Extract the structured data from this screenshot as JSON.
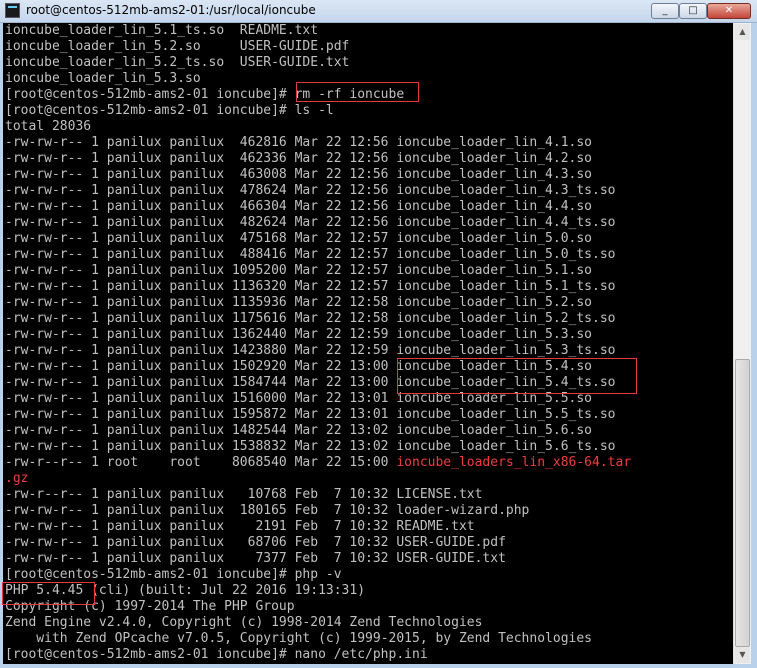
{
  "window": {
    "title": "root@centos-512mb-ams2-01:/usr/local/ioncube",
    "buttons": {
      "minimize": "_",
      "maximize": "□",
      "close": "✕"
    },
    "icon": "putty-terminal-icon"
  },
  "terminal": {
    "lines": [
      "ioncube_loader_lin_5.1_ts.so  README.txt",
      "ioncube_loader_lin_5.2.so     USER-GUIDE.pdf",
      "ioncube_loader_lin_5.2_ts.so  USER-GUIDE.txt",
      "ioncube_loader_lin_5.3.so",
      "[root@centos-512mb-ams2-01 ioncube]# rm -rf ioncube",
      "[root@centos-512mb-ams2-01 ioncube]# ls -l",
      "total 28036",
      "-rw-rw-r-- 1 panilux panilux  462816 Mar 22 12:56 ioncube_loader_lin_4.1.so",
      "-rw-rw-r-- 1 panilux panilux  462336 Mar 22 12:56 ioncube_loader_lin_4.2.so",
      "-rw-rw-r-- 1 panilux panilux  463008 Mar 22 12:56 ioncube_loader_lin_4.3.so",
      "-rw-rw-r-- 1 panilux panilux  478624 Mar 22 12:56 ioncube_loader_lin_4.3_ts.so",
      "-rw-rw-r-- 1 panilux panilux  466304 Mar 22 12:56 ioncube_loader_lin_4.4.so",
      "-rw-rw-r-- 1 panilux panilux  482624 Mar 22 12:56 ioncube_loader_lin_4.4_ts.so",
      "-rw-rw-r-- 1 panilux panilux  475168 Mar 22 12:57 ioncube_loader_lin_5.0.so",
      "-rw-rw-r-- 1 panilux panilux  488416 Mar 22 12:57 ioncube_loader_lin_5.0_ts.so",
      "-rw-rw-r-- 1 panilux panilux 1095200 Mar 22 12:57 ioncube_loader_lin_5.1.so",
      "-rw-rw-r-- 1 panilux panilux 1136320 Mar 22 12:57 ioncube_loader_lin_5.1_ts.so",
      "-rw-rw-r-- 1 panilux panilux 1135936 Mar 22 12:58 ioncube_loader_lin_5.2.so",
      "-rw-rw-r-- 1 panilux panilux 1175616 Mar 22 12:58 ioncube_loader_lin_5.2_ts.so",
      "-rw-rw-r-- 1 panilux panilux 1362440 Mar 22 12:59 ioncube_loader_lin_5.3.so",
      "-rw-rw-r-- 1 panilux panilux 1423880 Mar 22 12:59 ioncube_loader_lin_5.3_ts.so",
      "-rw-rw-r-- 1 panilux panilux 1502920 Mar 22 13:00 ioncube_loader_lin_5.4.so",
      "-rw-rw-r-- 1 panilux panilux 1584744 Mar 22 13:00 ioncube_loader_lin_5.4_ts.so",
      "-rw-rw-r-- 1 panilux panilux 1516000 Mar 22 13:01 ioncube_loader_lin_5.5.so",
      "-rw-rw-r-- 1 panilux panilux 1595872 Mar 22 13:01 ioncube_loader_lin_5.5_ts.so",
      "-rw-rw-r-- 1 panilux panilux 1482544 Mar 22 13:02 ioncube_loader_lin_5.6.so",
      "-rw-rw-r-- 1 panilux panilux 1538832 Mar 22 13:02 ioncube_loader_lin_5.6_ts.so",
      "-rw-r--r-- 1 root    root    8068540 Mar 22 15:00 ",
      "",
      "-rw-r--r-- 1 panilux panilux   10768 Feb  7 10:32 LICENSE.txt",
      "-rw-rw-r-- 1 panilux panilux  180165 Feb  7 10:32 loader-wizard.php",
      "-rw-rw-r-- 1 panilux panilux    2191 Feb  7 10:32 README.txt",
      "-rw-rw-r-- 1 panilux panilux   68706 Feb  7 10:32 USER-GUIDE.pdf",
      "-rw-rw-r-- 1 panilux panilux    7377 Feb  7 10:32 USER-GUIDE.txt",
      "[root@centos-512mb-ams2-01 ioncube]# php -v",
      "PHP 5.4.45 (cli) (built: Jul 22 2016 19:13:31)",
      "Copyright (c) 1997-2014 The PHP Group",
      "Zend Engine v2.4.0, Copyright (c) 1998-2014 Zend Technologies",
      "    with Zend OPcache v7.0.5, Copyright (c) 1999-2015, by Zend Technologies",
      "[root@centos-512mb-ams2-01 ioncube]# nano /etc/php.ini"
    ],
    "archive_name_part1": "ioncube_loaders_lin_x86-64.tar",
    "archive_name_part2": ".gz",
    "colors": {
      "background": "#000000",
      "text": "#c0c0c0",
      "archive": "#f03d3d",
      "highlight_box": "#e23b3b"
    }
  }
}
